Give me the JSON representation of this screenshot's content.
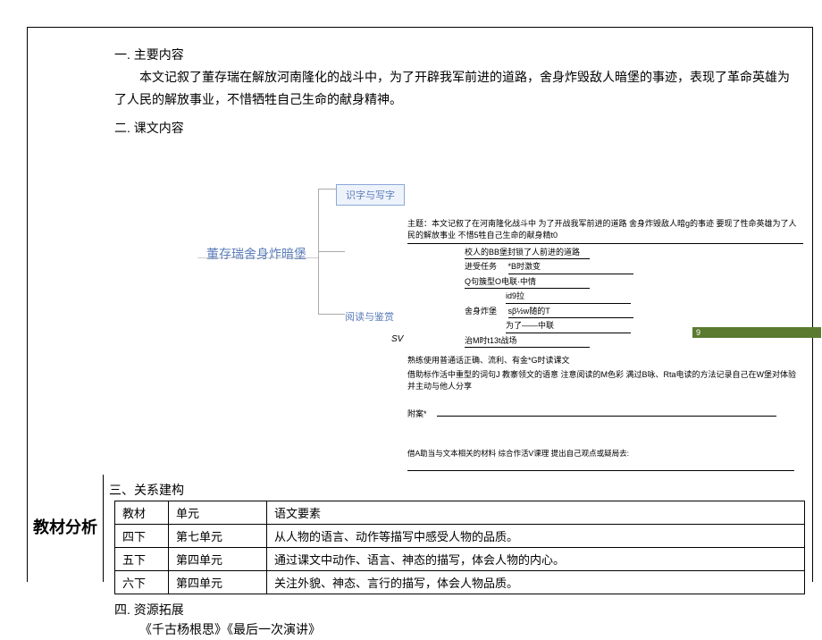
{
  "leftLabel": "教材分析",
  "section1": {
    "title": "一. 主要内容",
    "body": "本文记叙了董存瑞在解放河南隆化的战斗中，为了开辟我军前进的道路，舍身炸毁敌人暗堡的事迹，表现了革命英雄为了人民的解放事业，不惜牺牲自己生命的献身精神。"
  },
  "section2": {
    "title": "二. 课文内容",
    "mainNode": "董存瑞舍身炸暗堡",
    "literacyNode": "识字与写字",
    "readingNode": "阅读与鉴赏",
    "svLabel": "SV",
    "greenBar": "9",
    "rightBlock": {
      "topic": "主题：本文记叙了在河南隆化战斗中 为了开战我军前进的道路 舍身炸毁敌人暗g的事迹 要现了性命英雄为了人民的解放事业 不惜5牲自己生命的献身精t0",
      "line1": "校人的BB堡封锁了人前进的道路",
      "line2a": "进受任务",
      "line2b": "*B时激变",
      "line3": "Q句簇型O电联·中情",
      "line4": "id9拉",
      "line5a": "舍身炸堡",
      "line5b": "sβ½w随的T",
      "line6": "为了——中联",
      "line7": "治M时t13t战场",
      "note1": "熟练使用普通话正确、流利、有金*G时读课文",
      "note2": "借助标作活中重型的词句J 教寨领文的语意 注意阅读的M色彩 满过B咏、Rta电读的方法记录自己在W堡对体验 并主动与他人分享"
    },
    "attachLabel": "附案*",
    "footnote": "借A助当与文本相关的材料 综合作活V课理 提出自己观点或疑局去:"
  },
  "section3": {
    "title": "三、关系建构",
    "header": {
      "c1": "教材",
      "c2": "单元",
      "c3": "语文要素"
    },
    "rows": [
      {
        "c1": "四下",
        "c2": "第七单元",
        "c3": "从人物的语言、动作等描写中感受人物的品质。"
      },
      {
        "c1": "五下",
        "c2": "第四单元",
        "c3": "通过课文中动作、语言、神态的描写，体会人物的内心。"
      },
      {
        "c1": "六下",
        "c2": "第四单元",
        "c3": "关注外貌、神态、言行的描写，体会人物品质。"
      }
    ]
  },
  "section4": {
    "title": "四. 资源拓展",
    "books": "《千古杨根思》《最后一次演讲》"
  }
}
